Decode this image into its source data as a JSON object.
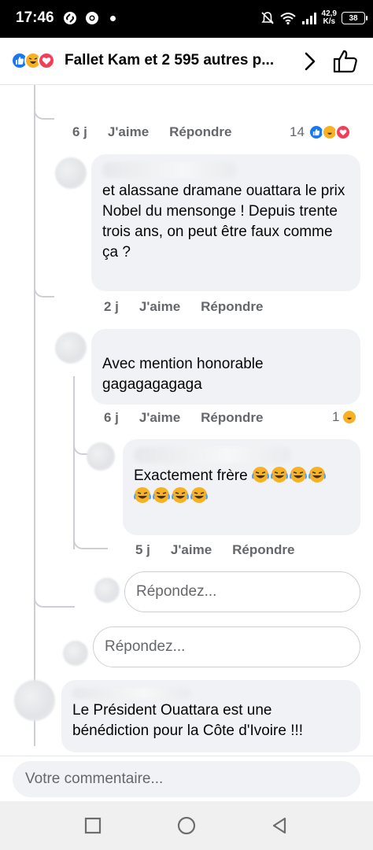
{
  "status_bar": {
    "time": "17:46",
    "net_speed_value": "42,9",
    "net_speed_unit": "K/s",
    "battery": "38"
  },
  "header": {
    "reaction_icons": [
      "like-icon",
      "haha-icon",
      "love-icon"
    ],
    "title": "Fallet Kam et 2 595 autres p..."
  },
  "comments": [
    {
      "age": "6 j",
      "like_label": "J'aime",
      "reply_label": "Répondre",
      "reaction_count": "14"
    },
    {
      "text": "et alassane dramane ouattara le prix Nobel du mensonge ! Depuis trente trois ans, on peut être faux comme ça ?",
      "age": "2 j",
      "like_label": "J'aime",
      "reply_label": "Répondre"
    },
    {
      "text": "Avec mention honorable gagagagagaga",
      "age": "6 j",
      "like_label": "J'aime",
      "reply_label": "Répondre",
      "reaction_count": "1"
    },
    {
      "text": "Exactement frère",
      "emoji_count": 8,
      "age": "5 j",
      "like_label": "J'aime",
      "reply_label": "Répondre"
    },
    {
      "text": "Le Président Ouattara est une bénédiction pour la Côte d'Ivoire  !!!"
    }
  ],
  "reply_inputs": {
    "nested_placeholder": "Répondez...",
    "thread_placeholder": "Répondez..."
  },
  "composer": {
    "placeholder": "Votre commentaire..."
  },
  "colors": {
    "facebook_blue": "#1877f2",
    "haha_yellow": "#f7b125",
    "love_red": "#f33e58",
    "bubble_grey": "#f0f2f5",
    "meta_grey": "#65676b"
  }
}
